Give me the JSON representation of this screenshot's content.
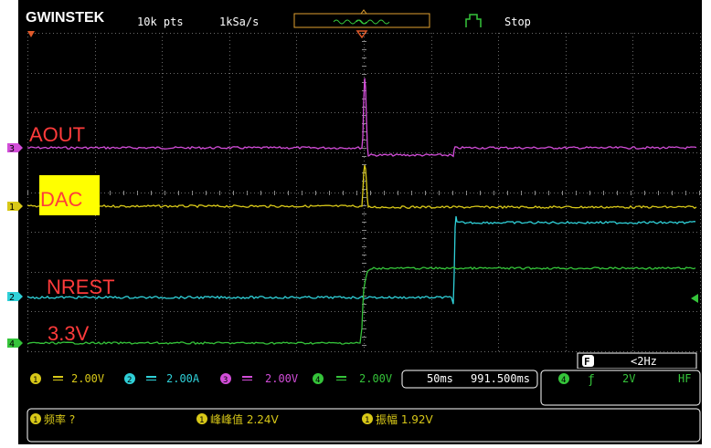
{
  "header": {
    "brand": "GWINSTEK",
    "points": "10k pts",
    "sample_rate": "1kSa/s",
    "run_state": "Stop"
  },
  "annotations": {
    "aout": "AOUT",
    "dac": "DAC",
    "nrest": "NREST",
    "v33": "3.3V"
  },
  "channel_markers": [
    "3",
    "1",
    "2",
    "4"
  ],
  "freq_counter": {
    "badge": "F",
    "value": "<2Hz"
  },
  "channels": [
    {
      "num": "1",
      "scale": "2.00V",
      "color": "#d8c818"
    },
    {
      "num": "2",
      "scale": "2.00A",
      "color": "#2fd0d8"
    },
    {
      "num": "3",
      "scale": "2.00V",
      "color": "#d24dd8"
    },
    {
      "num": "4",
      "scale": "2.00V",
      "color": "#35c43a"
    }
  ],
  "timebase": {
    "scale": "50ms",
    "position": "991.500ms"
  },
  "trigger": {
    "source": "4",
    "slope": "ƒ",
    "level": "2V",
    "coupling": "HF"
  },
  "measurements": [
    {
      "num": "1",
      "label": "频率 ?"
    },
    {
      "num": "1",
      "label": "峰峰值 2.24V"
    },
    {
      "num": "1",
      "label": "振幅 1.92V"
    }
  ],
  "colors": {
    "ch1": "#d8c818",
    "ch2": "#2fd0d8",
    "ch3": "#d24dd8",
    "ch4": "#35c43a",
    "annotation_red": "#ff3b3b",
    "annotation_highlight": "#ffff00",
    "background": "#000000"
  }
}
